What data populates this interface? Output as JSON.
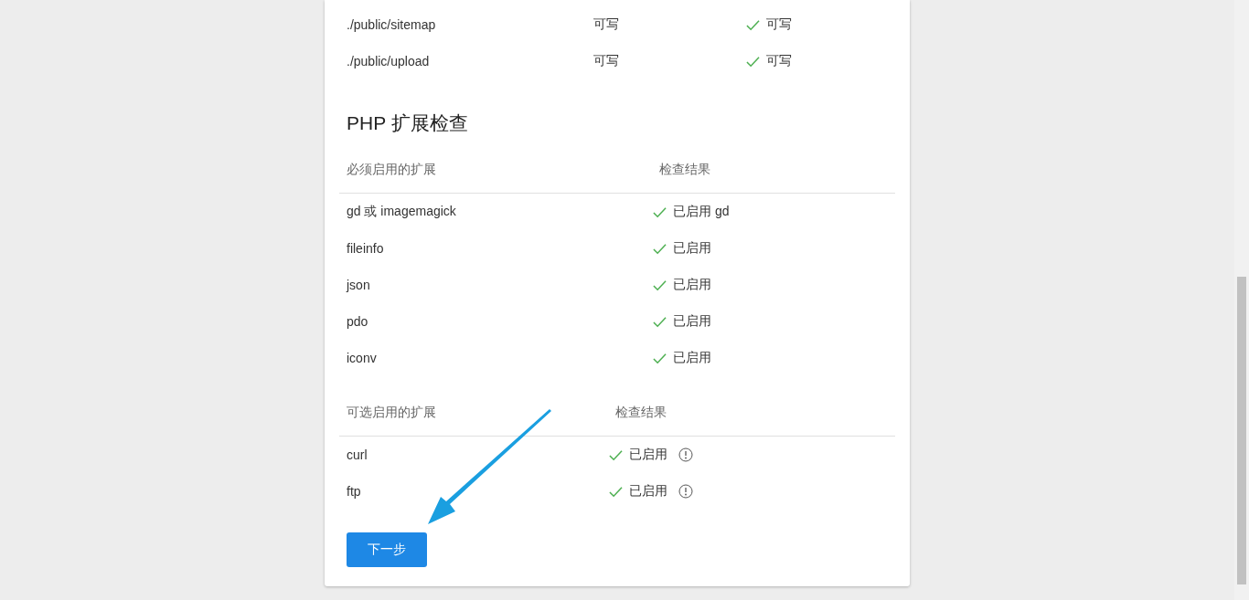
{
  "directories": [
    {
      "path": "./public/sitemap",
      "required": "可写",
      "result": "可写",
      "ok": true
    },
    {
      "path": "./public/upload",
      "required": "可写",
      "result": "可写",
      "ok": true
    }
  ],
  "extensions_section": {
    "title": "PHP 扩展检查",
    "required": {
      "columns": [
        "必须启用的扩展",
        "检查结果"
      ],
      "rows": [
        {
          "name": "gd 或 imagemagick",
          "result": "已启用 gd",
          "ok": true,
          "warning": false
        },
        {
          "name": "fileinfo",
          "result": "已启用",
          "ok": true,
          "warning": false
        },
        {
          "name": "json",
          "result": "已启用",
          "ok": true,
          "warning": false
        },
        {
          "name": "pdo",
          "result": "已启用",
          "ok": true,
          "warning": false
        },
        {
          "name": "iconv",
          "result": "已启用",
          "ok": true,
          "warning": false
        }
      ]
    },
    "optional": {
      "columns": [
        "可选启用的扩展",
        "检查结果"
      ],
      "rows": [
        {
          "name": "curl",
          "result": "已启用",
          "ok": true,
          "warning": true
        },
        {
          "name": "ftp",
          "result": "已启用",
          "ok": true,
          "warning": true
        }
      ]
    }
  },
  "next_button": "下一步"
}
